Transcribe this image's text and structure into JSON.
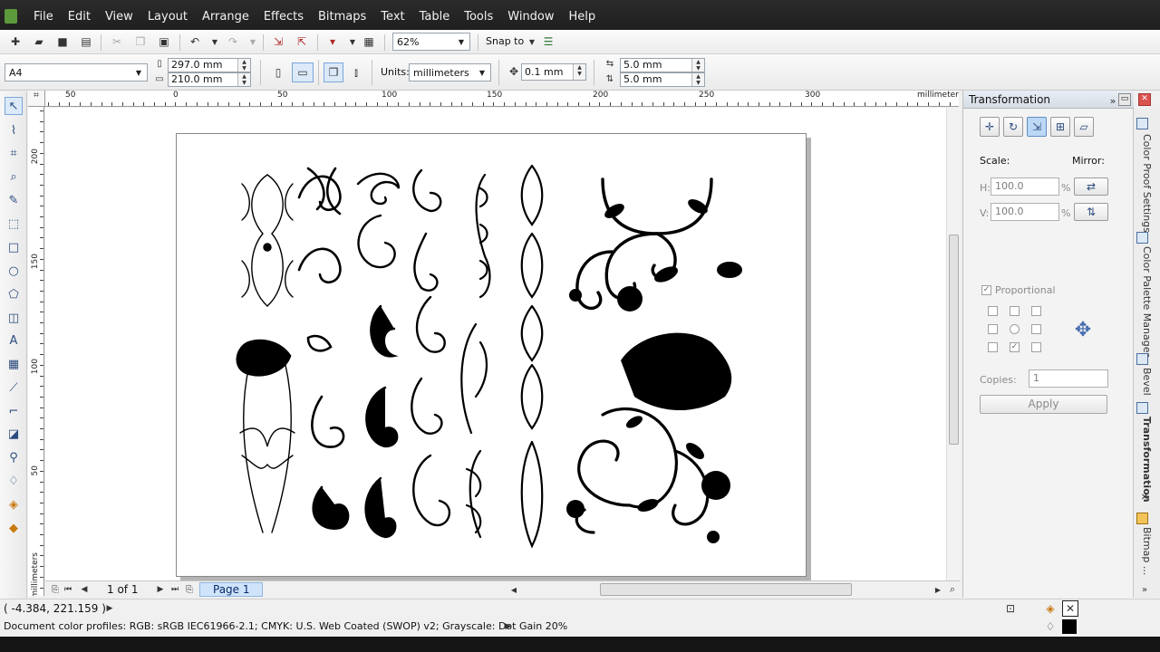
{
  "menu": [
    "File",
    "Edit",
    "View",
    "Layout",
    "Arrange",
    "Effects",
    "Bitmaps",
    "Text",
    "Table",
    "Tools",
    "Window",
    "Help"
  ],
  "standard_toolbar": {
    "zoom": "62%",
    "snap_to": "Snap to"
  },
  "property_bar": {
    "paper_size": "A4",
    "width": "297.0 mm",
    "height": "210.0 mm",
    "units_label": "Units:",
    "units": "millimeters",
    "nudge": "0.1 mm",
    "dup_x": "5.0 mm",
    "dup_y": "5.0 mm"
  },
  "ruler": {
    "h_ticks": [
      "50",
      "0",
      "50",
      "100",
      "150",
      "200",
      "250",
      "300"
    ],
    "h_unit": "millimeters",
    "v_ticks": [
      "200",
      "150",
      "100",
      "50"
    ],
    "v_unit": "millimeters"
  },
  "page_nav": {
    "count": "1 of 1",
    "tab": "Page 1"
  },
  "docker": {
    "title": "Transformation",
    "scale_label": "Scale:",
    "mirror_label": "Mirror:",
    "h_label": "H:",
    "h_value": "100.0",
    "v_label": "V:",
    "v_value": "100.0",
    "percent": "%",
    "proportional": "Proportional",
    "copies_label": "Copies:",
    "copies_value": "1",
    "apply": "Apply"
  },
  "side_tabs": [
    "Color Proof Settings",
    "Color Palette Manager",
    "Bevel",
    "Transformation",
    "Bitmap ..."
  ],
  "status": {
    "coords": "( -4.384, 221.159 )",
    "profiles": "Document color profiles: RGB: sRGB IEC61966-2.1; CMYK: U.S. Web Coated (SWOP) v2; Grayscale: Dot Gain 20%"
  },
  "colors": {
    "accent": "#cfe4fb",
    "menubar": "#232323",
    "ink": "#000000"
  }
}
